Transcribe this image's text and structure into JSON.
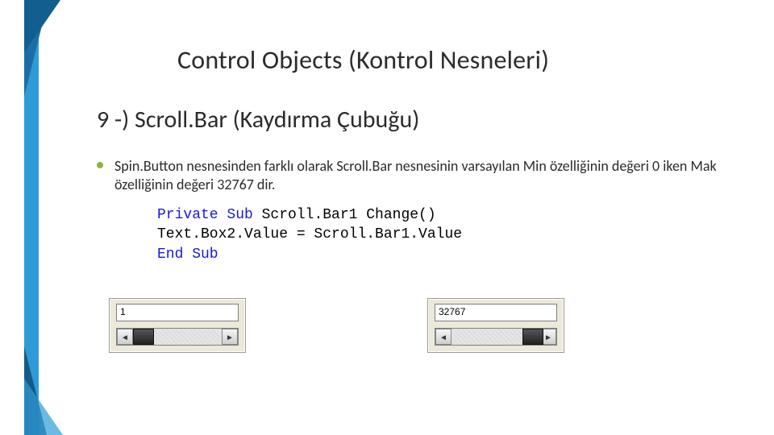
{
  "title": "Control Objects (Kontrol Nesneleri)",
  "subtitle": "9 -) Scroll.Bar (Kaydırma Çubuğu)",
  "bullet": "Spin.Button  nesnesinden farklı olarak Scroll.Bar nesnesinin varsayılan Min özelliğinin değeri 0 iken Mak özelliğinin değeri 32767 dir.",
  "code": {
    "line1a": "Private Sub",
    "line1b": " Scroll.Bar1 Change()",
    "line2": "Text.Box2.Value = Scroll.Bar1.Value",
    "line3": "End Sub"
  },
  "widgets": {
    "left": {
      "value": "1",
      "thumb_pos_pct": 0
    },
    "right": {
      "value": "32767",
      "thumb_pos_pct": 80
    }
  },
  "glyphs": {
    "arrow_left": "◄",
    "arrow_right": "►"
  }
}
